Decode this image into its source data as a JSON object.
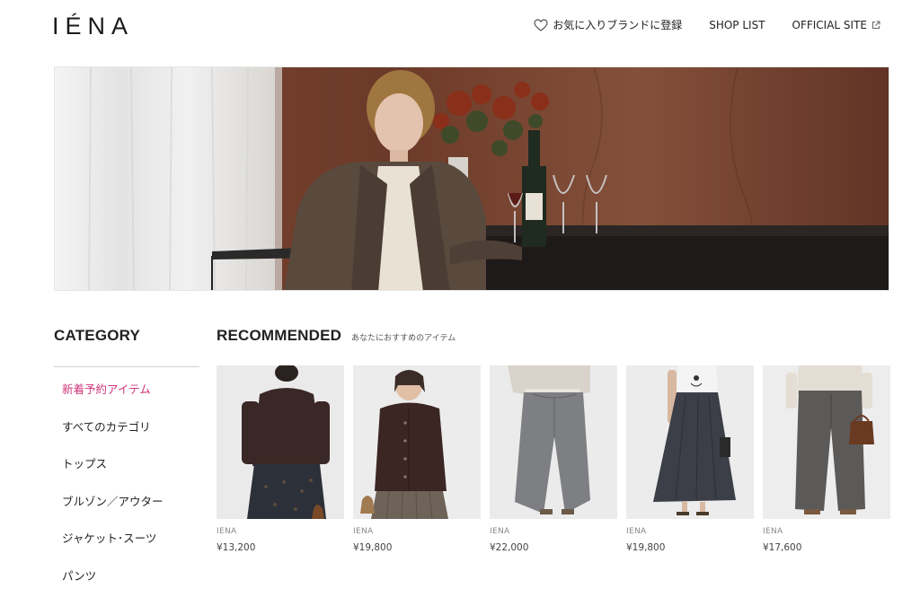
{
  "header": {
    "logo": "IÉNA",
    "favorite_label": "お気に入りブランドに登録",
    "shop_list_label": "SHOP LIST",
    "official_site_label": "OFFICIAL SITE"
  },
  "sidebar": {
    "title": "CATEGORY",
    "items": [
      {
        "label": "新着予約アイテム"
      },
      {
        "label": "すべてのカテゴリ"
      },
      {
        "label": "トップス"
      },
      {
        "label": "ブルゾン／アウター"
      },
      {
        "label": "ジャケット･スーツ"
      },
      {
        "label": "パンツ"
      }
    ],
    "active_color": "#d0367c"
  },
  "recommended": {
    "title": "RECOMMENDED",
    "subtitle": "あなたにおすすめのアイテム",
    "products": [
      {
        "brand": "IENA",
        "price": "¥13,200"
      },
      {
        "brand": "IENA",
        "price": "¥19,800"
      },
      {
        "brand": "IENA",
        "price": "¥22,000"
      },
      {
        "brand": "IENA",
        "price": "¥19,800"
      },
      {
        "brand": "IENA",
        "price": "¥17,600"
      }
    ]
  }
}
